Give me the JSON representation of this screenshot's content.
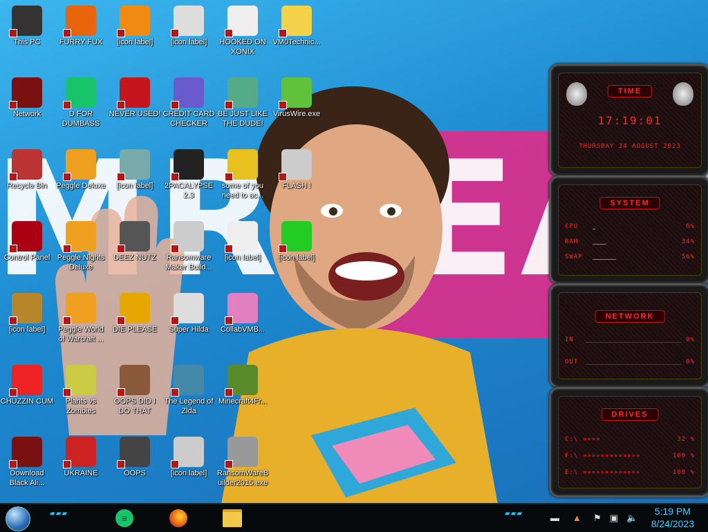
{
  "wallpaper": {
    "letters": "MRBEAS"
  },
  "desktop_icons": [
    {
      "label": "This PC",
      "icon": "computer-icon",
      "col": 0,
      "row": 0,
      "color": "#333"
    },
    {
      "label": "FURRY FUX",
      "icon": "firefox-icon",
      "col": 1,
      "row": 0,
      "color": "#e8650b"
    },
    {
      "label": "[icon label]",
      "icon": "vlc-cone-icon",
      "col": 2,
      "row": 0,
      "color": "#f08a10"
    },
    {
      "label": "[icon label]",
      "icon": "hxd-editor-icon",
      "col": 3,
      "row": 0,
      "color": "#ddd"
    },
    {
      "label": "HOOKED ON XONIX",
      "icon": "game-icon",
      "col": 4,
      "row": 0,
      "color": "#eee"
    },
    {
      "label": "VM0Technic...",
      "icon": "cartoon-icon",
      "col": 5,
      "row": 0,
      "color": "#f4d24a"
    },
    {
      "label": "Network",
      "icon": "network-orb-icon",
      "col": 0,
      "row": 1,
      "color": "#7a1010"
    },
    {
      "label": "D FOR DUMBASS",
      "icon": "chat-app-icon",
      "col": 1,
      "row": 1,
      "color": "#18c46a"
    },
    {
      "label": "NEVER USED!",
      "icon": "dev-cpp-icon",
      "col": 2,
      "row": 1,
      "color": "#c4161c"
    },
    {
      "label": "CREDIT CARD CHECKER",
      "icon": "credit-card-icon",
      "col": 3,
      "row": 1,
      "color": "#6a5acd"
    },
    {
      "label": "BE JUST LIKE THE DUDE!",
      "icon": "elf-icon",
      "col": 4,
      "row": 1,
      "color": "#5a8"
    },
    {
      "label": "VirusWire.exe",
      "icon": "lime-icon",
      "col": 5,
      "row": 1,
      "color": "#5fc23a"
    },
    {
      "label": "Recycle Bin",
      "icon": "recycle-bin-icon",
      "col": 0,
      "row": 2,
      "color": "#b33"
    },
    {
      "label": "Peggle Deluxe",
      "icon": "peggle-icon",
      "col": 1,
      "row": 2,
      "color": "#f0a020"
    },
    {
      "label": "[icon label]",
      "icon": "network-drive-icon",
      "col": 2,
      "row": 2,
      "color": "#7aa"
    },
    {
      "label": "2PACALYPSE 2.3",
      "icon": "terminal-icon",
      "col": 3,
      "row": 2,
      "color": "#222"
    },
    {
      "label": "some of you need to ac...",
      "icon": "dog-icon",
      "col": 4,
      "row": 2,
      "color": "#e8c020"
    },
    {
      "label": "FLASH !",
      "icon": "flash-icon",
      "col": 5,
      "row": 2,
      "color": "#ccc"
    },
    {
      "label": "Control Panel",
      "icon": "control-panel-icon",
      "col": 0,
      "row": 3,
      "color": "#a01"
    },
    {
      "label": "Peggle Nights Deluxe",
      "icon": "peggle-icon",
      "col": 1,
      "row": 3,
      "color": "#f0a020"
    },
    {
      "label": "DEEZ NUTZ",
      "icon": "stacked-windows-icon",
      "col": 2,
      "row": 3,
      "color": "#555"
    },
    {
      "label": "Ransomware Maker Build...",
      "icon": "window-icon",
      "col": 3,
      "row": 3,
      "color": "#ccc"
    },
    {
      "label": "[icon label]",
      "icon": "arrows-icon",
      "col": 4,
      "row": 3,
      "color": "#eee"
    },
    {
      "label": "[icon label]",
      "icon": "checkmark-icon",
      "col": 5,
      "row": 3,
      "color": "#2c2"
    },
    {
      "label": "[icon label]",
      "icon": "money-bag-icon",
      "col": 0,
      "row": 4,
      "color": "#b8862a"
    },
    {
      "label": "Peggle World of Warcraft ...",
      "icon": "peggle-icon",
      "col": 1,
      "row": 4,
      "color": "#f0a020"
    },
    {
      "label": "DIE PLEASE",
      "icon": "de-icon",
      "col": 2,
      "row": 4,
      "color": "#e6a800"
    },
    {
      "label": "Super Hilda",
      "icon": "pixel-art-icon",
      "col": 3,
      "row": 4,
      "color": "#ddd"
    },
    {
      "label": "CollabVMB...",
      "icon": "monitor-pink-icon",
      "col": 4,
      "row": 4,
      "color": "#e080c0"
    },
    {
      "label": "CHUZZIN CUM",
      "icon": "chuzzle-icon",
      "col": 0,
      "row": 5,
      "color": "#e22"
    },
    {
      "label": "Plants vs Zombies",
      "icon": "flower-icon",
      "col": 1,
      "row": 5,
      "color": "#cc4"
    },
    {
      "label": "OOPS DID I DO THAT",
      "icon": "portrait-icon",
      "col": 2,
      "row": 5,
      "color": "#8a5a3a"
    },
    {
      "label": "The Legend of Zlda",
      "icon": "sprite-icon",
      "col": 3,
      "row": 5,
      "color": "#48a"
    },
    {
      "label": "Minecraft4Fr...",
      "icon": "grass-block-icon",
      "col": 4,
      "row": 5,
      "color": "#5a8a2a"
    },
    {
      "label": "Download Black Ali...",
      "icon": "alienware-orb-icon",
      "col": 0,
      "row": 6,
      "color": "#7a1010"
    },
    {
      "label": "UKRAINE",
      "icon": "radiation-icon",
      "col": 1,
      "row": 6,
      "color": "#c22"
    },
    {
      "label": "OOPS",
      "icon": "dark-app-icon",
      "col": 2,
      "row": 6,
      "color": "#444"
    },
    {
      "label": "[icon label]",
      "icon": "padlock-icon",
      "col": 3,
      "row": 6,
      "color": "#ccc"
    },
    {
      "label": "RansomWareBuilder2015.exe",
      "icon": "skull-icon",
      "col": 4,
      "row": 6,
      "color": "#999"
    }
  ],
  "widgets": {
    "time": {
      "title": "TIME",
      "clock": "17:19:01",
      "date": "THURSDAY 24 AUGUST 2023"
    },
    "system": {
      "title": "SYSTEM",
      "rows": [
        {
          "label": "CPU",
          "value": "6%",
          "level": 0.06
        },
        {
          "label": "RAM",
          "value": "34%",
          "level": 0.34
        },
        {
          "label": "SWAP",
          "value": "56%",
          "level": 0.56
        }
      ]
    },
    "network": {
      "title": "NETWORK",
      "rows": [
        {
          "label": "IN",
          "value": "0%"
        },
        {
          "label": "OUT",
          "value": "0%"
        }
      ]
    },
    "drives": {
      "title": "DRIVES",
      "rows": [
        {
          "label": "C:\\",
          "value": "32 %"
        },
        {
          "label": "F:\\",
          "value": "100 %"
        },
        {
          "label": "E:\\",
          "value": "100 %"
        }
      ]
    }
  },
  "taskbar": {
    "apps": [
      {
        "name": "chat-app-icon",
        "color": "#18c46a"
      },
      {
        "name": "firefox-icon",
        "color": "#e8650b"
      },
      {
        "name": "file-explorer-icon",
        "color": "#f2c94c"
      }
    ],
    "time": "5:19 PM",
    "date": "8/24/2023"
  }
}
